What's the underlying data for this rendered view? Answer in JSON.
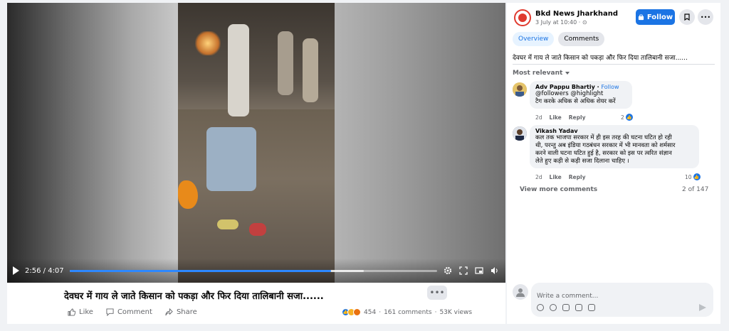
{
  "video": {
    "current_time": "2:56",
    "duration": "4:07",
    "progress_fraction": 0.712,
    "buffered_fraction": 0.8,
    "accent_color": "#2d88ff"
  },
  "post": {
    "title": "देवघर में गाय ले जाते किसान को पकड़ा और फिर दिया तालिबानी सजा......",
    "actions": {
      "like": "Like",
      "comment": "Comment",
      "share": "Share"
    },
    "stats": {
      "reaction_count": "454",
      "comments": "161 comments",
      "views": "53K views",
      "separator": "·"
    },
    "more_icon": "ellipsis-icon"
  },
  "panel": {
    "page_name": "Bkd News Jharkhand",
    "page_time": "3 July at 10:40 · ⊙",
    "follow_label": "Follow",
    "tabs": [
      "Overview",
      "Comments"
    ],
    "caption": "देवघर में गाय ले जाते किसान को पकड़ा और फिर दिया तालिबानी सजा......",
    "sort_label": "Most relevant",
    "comments": [
      {
        "name": "Adv Pappu Bhartiy",
        "follow": "Follow",
        "text": [
          "@followers @highlight",
          "टैग करके अधिक से अधिक शेयर करें"
        ],
        "time": "2d",
        "like": "Like",
        "reply": "Reply",
        "likes": "2"
      },
      {
        "name": "Vikash Yadav",
        "follow": "",
        "text": [
          "कल तक भाजपा सरकार में ही इस तरह की घटना घटित हो रही",
          "थी, परन्तु अब इंडिया गठबंधन सरकार में भी मानवता को शर्मसार",
          "करने वाली घटना घटित हुई है, सरकार को इस पर त्वरित संज्ञान",
          "लेते हुए कड़ी से कड़ी सजा दिलाना चाहिए ।"
        ],
        "time": "2d",
        "like": "Like",
        "reply": "Reply",
        "likes": "10"
      }
    ],
    "view_more": "View more comments",
    "count": "2 of 147",
    "write_placeholder": "Write a comment...",
    "brand_color": "#1b74e4"
  }
}
